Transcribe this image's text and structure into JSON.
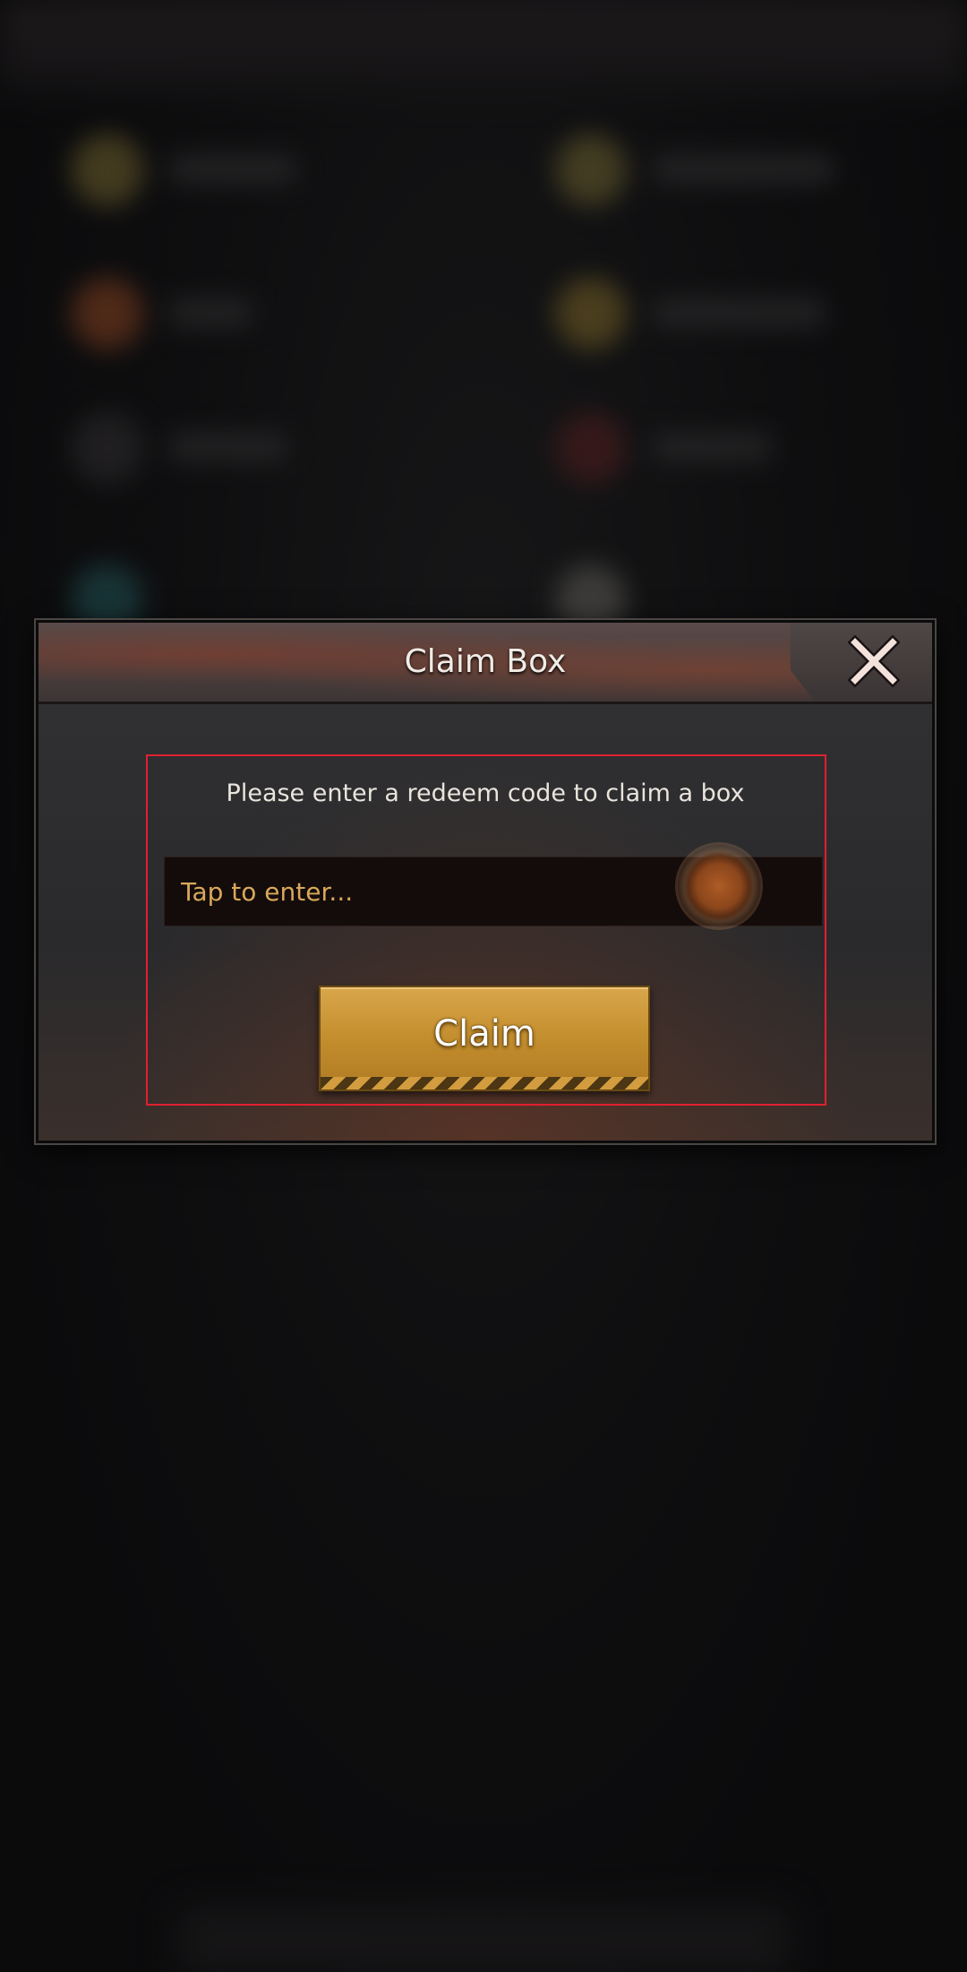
{
  "dialog": {
    "title": "Claim Box",
    "close_icon": "close-x-icon",
    "prompt": "Please enter a redeem code to claim a box",
    "code_input": {
      "value": "",
      "placeholder": "Tap to enter..."
    },
    "claim_label": "Claim"
  },
  "colors": {
    "accent_gold": "#c5902f",
    "placeholder_gold": "#d9a85a",
    "highlight_red": "#e02030",
    "panel_dark": "#2b2b2d"
  }
}
